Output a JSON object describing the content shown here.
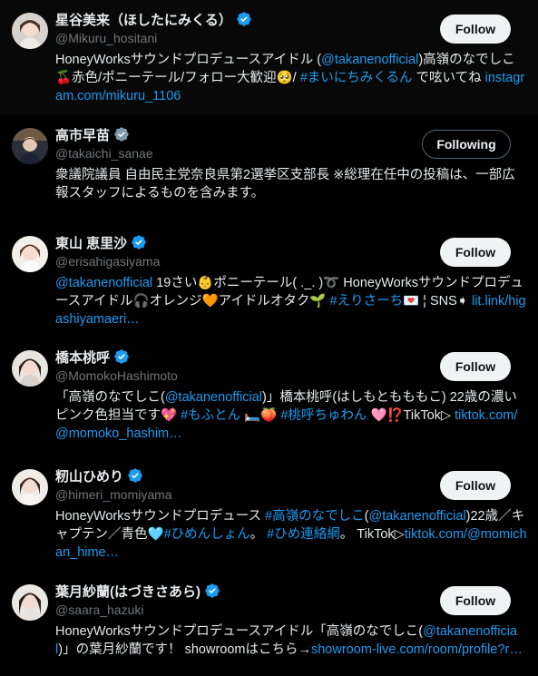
{
  "users": [
    {
      "name": "星谷美来（ほしたにみくる）",
      "handle": "@Mikuru_hositani",
      "verified_color": "#1d9bf0",
      "button": "Follow",
      "bio": [
        {
          "t": "HoneyWorksサウンドプロデュースアイドル ("
        },
        {
          "t": "@takanenofficial",
          "link": true
        },
        {
          "t": ")高嶺のなでしこ 🍒赤色/ポニーテール/フォロー大歓迎🥺/ "
        },
        {
          "t": "#まいにちみくるん",
          "link": true
        },
        {
          "t": " で呟いてね "
        },
        {
          "t": "instagram.com/mikuru_1106",
          "link": true
        }
      ]
    },
    {
      "name": "高市早苗",
      "handle": "@takaichi_sanae",
      "verified_color": "#829aab",
      "button": "Following",
      "bio": [
        {
          "t": "衆議院議員 自由民主党奈良県第2選挙区支部長 ※総理在任中の投稿は、一部広報スタッフによるものを含みます。"
        }
      ]
    },
    {
      "name": "東山 恵里沙",
      "handle": "@erisahigasiyama",
      "verified_color": "#1d9bf0",
      "button": "Follow",
      "bio": [
        {
          "t": "@takanenofficial",
          "link": true
        },
        {
          "t": " 19さい👶ポニーテール( ._. )➰ HoneyWorksサウンドプロデュースアイドル🎧オレンジ🧡アイドルオタク🌱 "
        },
        {
          "t": "#えりさーち",
          "link": true
        },
        {
          "t": "💌 ¦ SNS➧ "
        },
        {
          "t": "lit.link/higashiyamaeri…",
          "link": true
        }
      ]
    },
    {
      "name": "橋本桃呼",
      "handle": "@MomokoHashimoto",
      "verified_color": "#1d9bf0",
      "button": "Follow",
      "bio": [
        {
          "t": "「高嶺のなでしこ("
        },
        {
          "t": "@takanenofficial",
          "link": true
        },
        {
          "t": ")」橋本桃呼(はしもともももこ) 22歳の濃いピンク色担当です💖 "
        },
        {
          "t": "#もふとん",
          "link": true
        },
        {
          "t": " 🛏️🍑 "
        },
        {
          "t": "#桃呼ちゅわん",
          "link": true
        },
        {
          "t": " 🩷⁉️TikTok▷ "
        },
        {
          "t": "tiktok.com/@momoko_hashim…",
          "link": true
        }
      ]
    },
    {
      "name": "籾山ひめり",
      "handle": "@himeri_momiyama",
      "verified_color": "#1d9bf0",
      "button": "Follow",
      "bio": [
        {
          "t": "HoneyWorksサウンドプロデュース "
        },
        {
          "t": "#高嶺のなでしこ",
          "link": true
        },
        {
          "t": "("
        },
        {
          "t": "@takanenofficial",
          "link": true
        },
        {
          "t": ")22歳／キャプテン／青色🩵"
        },
        {
          "t": "#ひめんしょん",
          "link": true
        },
        {
          "t": "。 "
        },
        {
          "t": "#ひめ連絡網",
          "link": true
        },
        {
          "t": "。 TikTok▷"
        },
        {
          "t": "tiktok.com/@momichan_hime…",
          "link": true
        }
      ]
    },
    {
      "name": "葉月紗蘭(はづきさあら)",
      "handle": "@saara_hazuki",
      "verified_color": "#1d9bf0",
      "button": "Follow",
      "bio": [
        {
          "t": "HoneyWorksサウンドプロデュースアイドル「高嶺のなでしこ("
        },
        {
          "t": "@takanenofficial",
          "link": true
        },
        {
          "t": ")」の葉月紗蘭です！ showroomはこちら→"
        },
        {
          "t": "showroom-live.com/room/profile?r…",
          "link": true
        }
      ]
    }
  ]
}
